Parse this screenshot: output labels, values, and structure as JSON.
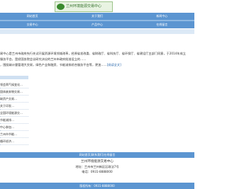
{
  "header": {
    "logo_text": "兰州环境能源交易中心"
  },
  "nav_primary": [
    "网站首页",
    "关于我们",
    "新闻中心"
  ],
  "nav_secondary": [
    "交易中心",
    "产品中心",
    "在线留言"
  ],
  "intro": {
    "line1": "易中心是兰州市政府先行先试开展资源环境领域改革，经原省发改委、省财政厅、省科技厅、省环保厅、省建设厅五部门同意，于2014年成立",
    "line2": "服务平台，是经国务院会议研究决议的兰州市政府批准设立的……",
    "line3": "，围绕碳计量管理大交易，绿色产业和融资、节能减排综合服务平台等，更加……",
    "more": "[阅读全文]"
  },
  "news_list": [
    "领会两气候变化…",
    "固体废弃物交易…",
    "碳资产交易…",
    "关于印发…",
    "全国环境能源交…",
    "节能减排…",
    "中心参加…",
    "兰州市节能…",
    "循环经济…"
  ],
  "footer": {
    "links": "网站首页|联系我们|在线留言",
    "org": "兰州环境能源交易中心",
    "address": "地址：兰州市兰州新区区政法7号",
    "phone": "电话：0931-8888000",
    "copyright": "版权所有：0931-8888000"
  }
}
